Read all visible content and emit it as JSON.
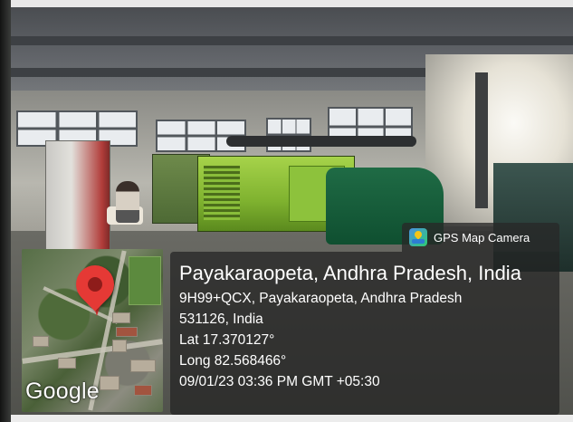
{
  "photo": {
    "scene": "generator room"
  },
  "overlay": {
    "app_badge": "GPS Map Camera",
    "app_icon": "gps-map-camera-icon",
    "title": "Payakaraopeta, Andhra Pradesh, India",
    "address_line1": "9H99+QCX, Payakaraopeta, Andhra Pradesh",
    "address_line2": "531126, India",
    "latitude": "Lat 17.370127°",
    "longitude": "Long 82.568466°",
    "datetime": "09/01/23 03:36 PM GMT +05:30",
    "map_brand": "Google",
    "pin_color": "#e53935"
  }
}
